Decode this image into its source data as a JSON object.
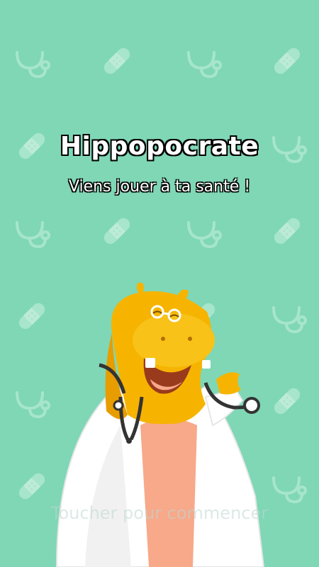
{
  "game": {
    "title": "Hippopocrate",
    "subtitle": "Viens jouer à ta santé !",
    "start_prompt": "Toucher pour commencer"
  },
  "colors": {
    "background": "#7fd7b5",
    "pattern": "#a7e5cd",
    "hippo_body": "#f6b400",
    "hippo_shadow": "#e79c00",
    "coat": "#ffffff",
    "neck": "#f7a98a",
    "stethoscope": "#333333"
  },
  "icons": [
    "stethoscope-icon",
    "bandage-icon"
  ]
}
